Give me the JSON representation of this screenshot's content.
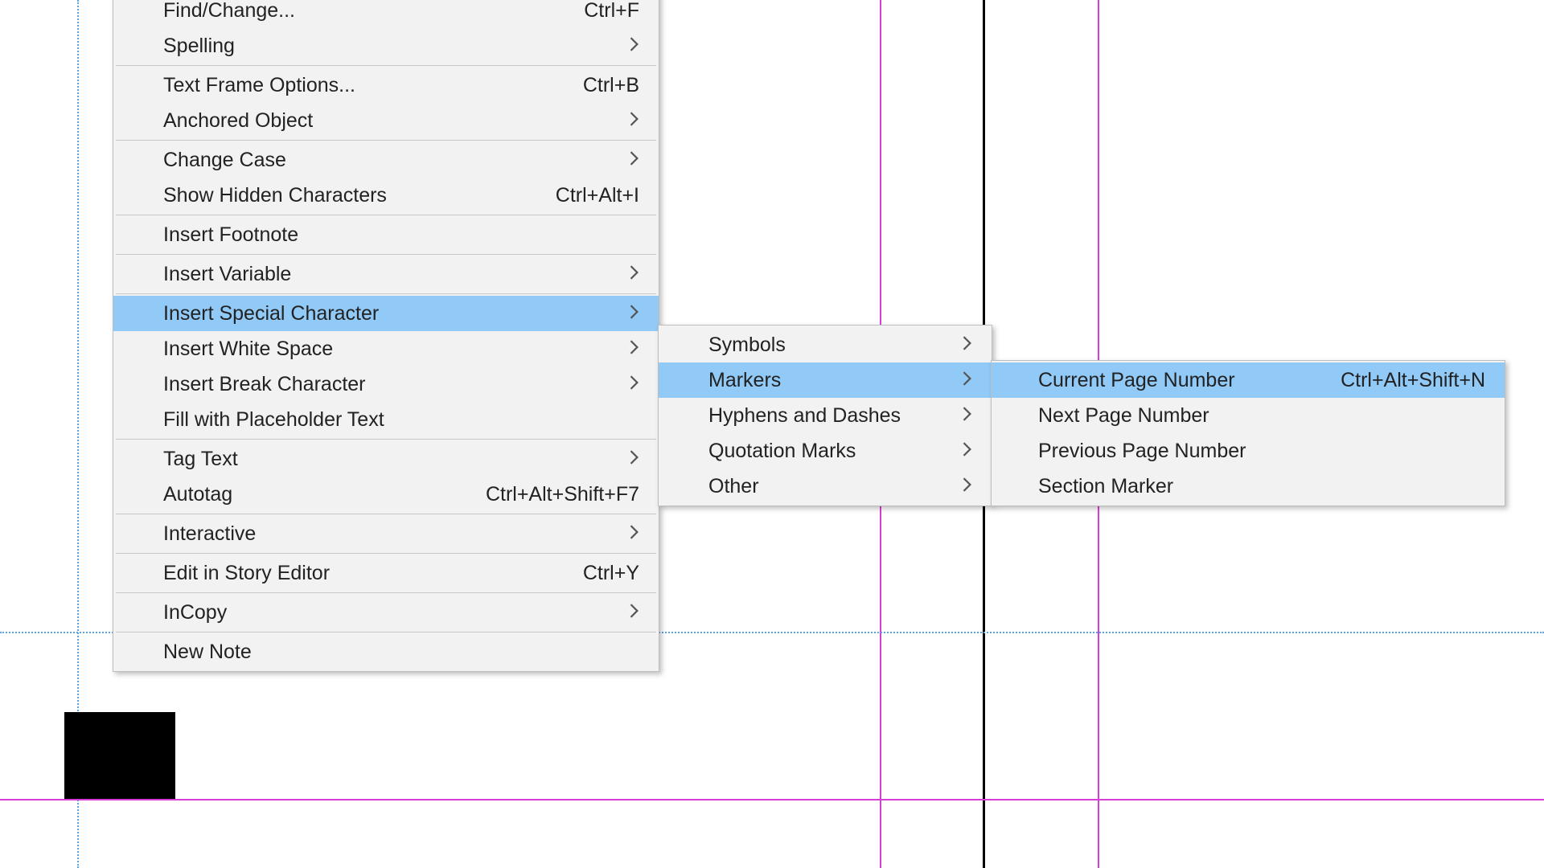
{
  "main_menu": {
    "items": [
      {
        "label": "Find/Change...",
        "shortcut": "Ctrl+F",
        "submenu": false
      },
      {
        "label": "Spelling",
        "shortcut": "",
        "submenu": true
      },
      {
        "sep": true
      },
      {
        "label": "Text Frame Options...",
        "shortcut": "Ctrl+B",
        "submenu": false
      },
      {
        "label": "Anchored Object",
        "shortcut": "",
        "submenu": true
      },
      {
        "sep": true
      },
      {
        "label": "Change Case",
        "shortcut": "",
        "submenu": true
      },
      {
        "label": "Show Hidden Characters",
        "shortcut": "Ctrl+Alt+I",
        "submenu": false
      },
      {
        "sep": true
      },
      {
        "label": "Insert Footnote",
        "shortcut": "",
        "submenu": false
      },
      {
        "sep": true
      },
      {
        "label": "Insert Variable",
        "shortcut": "",
        "submenu": true
      },
      {
        "sep": true
      },
      {
        "label": "Insert Special Character",
        "shortcut": "",
        "submenu": true,
        "highlight": true
      },
      {
        "label": "Insert White Space",
        "shortcut": "",
        "submenu": true
      },
      {
        "label": "Insert Break Character",
        "shortcut": "",
        "submenu": true
      },
      {
        "label": "Fill with Placeholder Text",
        "shortcut": "",
        "submenu": false
      },
      {
        "sep": true
      },
      {
        "label": "Tag Text",
        "shortcut": "",
        "submenu": true
      },
      {
        "label": "Autotag",
        "shortcut": "Ctrl+Alt+Shift+F7",
        "submenu": false
      },
      {
        "sep": true
      },
      {
        "label": "Interactive",
        "shortcut": "",
        "submenu": true
      },
      {
        "sep": true
      },
      {
        "label": "Edit in Story Editor",
        "shortcut": "Ctrl+Y",
        "submenu": false
      },
      {
        "sep": true
      },
      {
        "label": "InCopy",
        "shortcut": "",
        "submenu": true
      },
      {
        "sep": true
      },
      {
        "label": "New Note",
        "shortcut": "",
        "submenu": false
      }
    ]
  },
  "sub_menu_1": {
    "items": [
      {
        "label": "Symbols",
        "submenu": true
      },
      {
        "label": "Markers",
        "submenu": true,
        "highlight": true
      },
      {
        "label": "Hyphens and Dashes",
        "submenu": true
      },
      {
        "label": "Quotation Marks",
        "submenu": true
      },
      {
        "label": "Other",
        "submenu": true
      }
    ]
  },
  "sub_menu_2": {
    "items": [
      {
        "label": "Current Page Number",
        "shortcut": "Ctrl+Alt+Shift+N",
        "highlight": true
      },
      {
        "label": "Next Page Number",
        "shortcut": ""
      },
      {
        "label": "Previous Page Number",
        "shortcut": ""
      },
      {
        "label": "Section Marker",
        "shortcut": ""
      }
    ]
  }
}
